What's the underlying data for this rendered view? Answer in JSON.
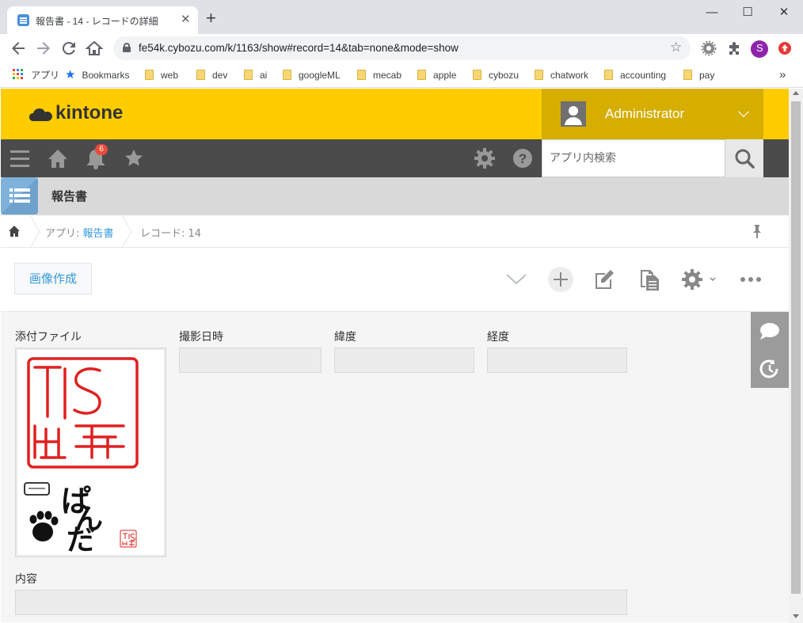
{
  "browser": {
    "tab_title": "報告書 - 14 - レコードの詳細",
    "tab_close": "✕",
    "new_tab": "+",
    "url": "fe54k.cybozu.com/k/1163/show#record=14&tab=none&mode=show",
    "profile_initial": "S",
    "window_controls": {
      "minimize": "—",
      "maximize": "☐",
      "close": "✕"
    },
    "bookmarks": [
      {
        "label": "アプリ",
        "icon": "apps-grid-icon"
      },
      {
        "label": "Bookmarks",
        "icon": "star-icon"
      },
      {
        "label": "web",
        "icon": "folder-icon"
      },
      {
        "label": "dev",
        "icon": "folder-icon"
      },
      {
        "label": "ai",
        "icon": "folder-icon"
      },
      {
        "label": "googleML",
        "icon": "folder-icon"
      },
      {
        "label": "mecab",
        "icon": "folder-icon"
      },
      {
        "label": "apple",
        "icon": "folder-icon"
      },
      {
        "label": "cybozu",
        "icon": "folder-icon"
      },
      {
        "label": "chatwork",
        "icon": "folder-icon"
      },
      {
        "label": "accounting",
        "icon": "folder-icon"
      },
      {
        "label": "pay",
        "icon": "folder-icon"
      }
    ],
    "bookmarks_overflow": "»"
  },
  "header": {
    "logo_text": "kintone",
    "user_name": "Administrator",
    "brand_color": "#ffcc00"
  },
  "nav": {
    "notification_count": "6",
    "search_placeholder": "アプリ内検索"
  },
  "app": {
    "title": "報告書"
  },
  "breadcrumb": {
    "app_prefix": "アプリ: ",
    "app_link": "報告書",
    "record_label": "レコード: 14"
  },
  "actions": {
    "image_button_label": "画像作成"
  },
  "record": {
    "fields": {
      "attachment_label": "添付ファイル",
      "datetime_label": "撮影日時",
      "latitude_label": "緯度",
      "longitude_label": "経度",
      "content_label": "内容",
      "datetime_value": "",
      "latitude_value": "",
      "longitude_value": "",
      "content_value": ""
    },
    "attachment_image": {
      "seal_text_big": "TIS",
      "seal_text_small": "TIS",
      "handwriting": [
        "ぱ",
        "ん",
        "だ"
      ],
      "stamp_color": "#e02020"
    }
  }
}
